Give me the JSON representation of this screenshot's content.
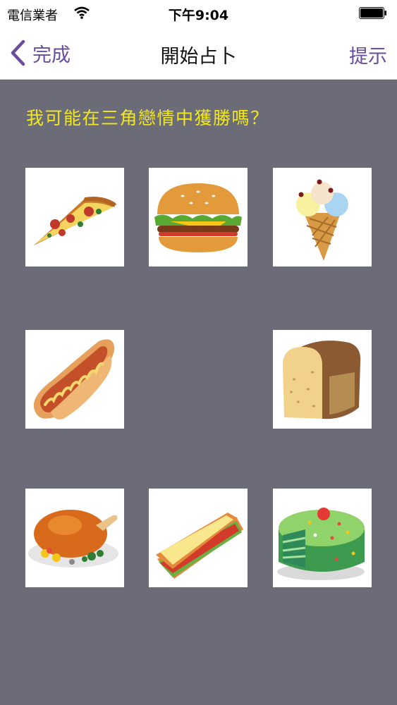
{
  "status_bar": {
    "carrier": "電信業者",
    "time": "下午9:04",
    "icons": [
      "wifi-icon",
      "battery-icon"
    ]
  },
  "nav": {
    "back_label": "完成",
    "title": "開始占卜",
    "hint_label": "提示"
  },
  "question": "我可能在三角戀情中獲勝嗎？",
  "grid": {
    "cards": [
      {
        "item": "pizza-slice-icon"
      },
      {
        "item": "hamburger-icon"
      },
      {
        "item": "ice-cream-cone-icon"
      },
      {
        "item": "hot-dog-icon"
      },
      {
        "item": "empty-slot"
      },
      {
        "item": "bread-loaf-icon"
      },
      {
        "item": "roast-chicken-icon"
      },
      {
        "item": "sandwich-icon"
      },
      {
        "item": "green-cake-icon"
      }
    ]
  },
  "colors": {
    "accent": "#6a4c9c",
    "background": "#6b6c77",
    "question_text": "#f2e81f"
  }
}
